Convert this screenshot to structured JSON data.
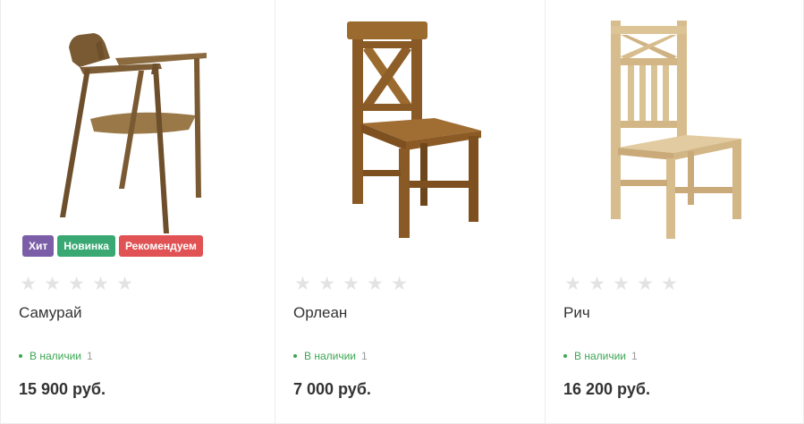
{
  "colors": {
    "in_stock": "#3aa652",
    "star_empty": "#e3e3e3"
  },
  "products": [
    {
      "name": "Самурай",
      "image_icon": "armchair-image",
      "badges": [
        {
          "label": "Хит",
          "color": "#7b5ea7"
        },
        {
          "label": "Новинка",
          "color": "#3aa873"
        },
        {
          "label": "Рекомендуем",
          "color": "#e05253"
        }
      ],
      "rating": 0,
      "stock_label": "В наличии",
      "stock_count": "1",
      "price": "15 900 руб."
    },
    {
      "name": "Орлеан",
      "image_icon": "x-back-chair-image",
      "badges": [],
      "rating": 0,
      "stock_label": "В наличии",
      "stock_count": "1",
      "price": "7 000 руб."
    },
    {
      "name": "Рич",
      "image_icon": "slat-back-chair-image",
      "badges": [],
      "rating": 0,
      "stock_label": "В наличии",
      "stock_count": "1",
      "price": "16 200 руб."
    }
  ]
}
